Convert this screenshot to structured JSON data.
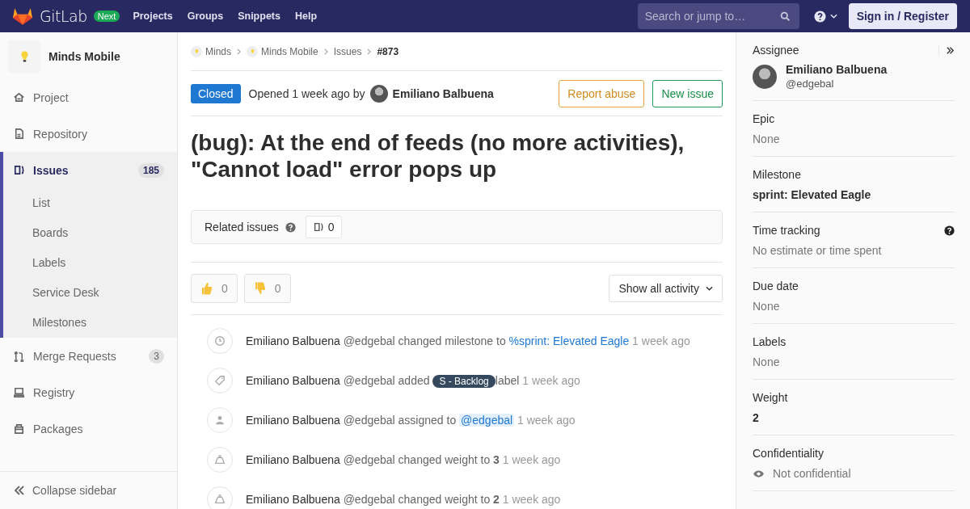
{
  "navbar": {
    "brand": "GitLab",
    "badge": "Next",
    "links": [
      "Projects",
      "Groups",
      "Snippets",
      "Help"
    ],
    "search": {
      "placeholder": "Search or jump to…"
    },
    "sign_in": "Sign in / Register"
  },
  "sidebar": {
    "project": "Minds Mobile",
    "items": [
      {
        "label": "Project",
        "kind": "home",
        "selected": false
      },
      {
        "label": "Repository",
        "kind": "doc",
        "selected": false
      },
      {
        "label": "Issues",
        "kind": "issues",
        "selected": true,
        "count": "185",
        "children": [
          {
            "label": "List"
          },
          {
            "label": "Boards"
          },
          {
            "label": "Labels"
          },
          {
            "label": "Service Desk"
          },
          {
            "label": "Milestones"
          }
        ]
      },
      {
        "label": "Merge Requests",
        "kind": "merge",
        "selected": false,
        "count": "3"
      },
      {
        "label": "Registry",
        "kind": "registry",
        "selected": false
      },
      {
        "label": "Packages",
        "kind": "package",
        "selected": false
      }
    ],
    "collapse": "Collapse sidebar"
  },
  "breadcrumbs": [
    {
      "label": "Minds",
      "icon": true
    },
    {
      "label": "Minds Mobile",
      "icon": true
    },
    {
      "label": "Issues",
      "icon": false
    },
    {
      "label": "#873",
      "icon": false
    }
  ],
  "issue": {
    "status": "Closed",
    "opened": "Opened 1 week ago by",
    "author": "Emiliano Balbuena",
    "report": "Report abuse",
    "new_issue": "New issue",
    "title": "(bug): At the end of feeds (no more activities), \"Cannot load\" error pops up"
  },
  "related": {
    "label": "Related issues",
    "count": "0"
  },
  "reactions": [
    {
      "kind": "up",
      "count": "0"
    },
    {
      "kind": "down",
      "count": "0"
    }
  ],
  "activity_filter": "Show all activity",
  "activity": [
    {
      "kind": "clock",
      "author": "Emiliano Balbuena",
      "handle": "@edgebal",
      "action": "changed milestone to",
      "ref": {
        "kind": "link",
        "text": "%sprint: Elevated Eagle"
      },
      "time": "1 week ago"
    },
    {
      "kind": "tag",
      "author": "Emiliano Balbuena",
      "handle": "@edgebal",
      "action": "added",
      "ref": {
        "kind": "label",
        "text": "S - Backlog"
      },
      "after": "label",
      "time": "1 week ago"
    },
    {
      "kind": "user",
      "author": "Emiliano Balbuena",
      "handle": "@edgebal",
      "action": "assigned to",
      "ref": {
        "kind": "mention",
        "text": "@edgebal"
      },
      "time": "1 week ago"
    },
    {
      "kind": "weight",
      "author": "Emiliano Balbuena",
      "handle": "@edgebal",
      "action": "changed weight to **3**",
      "time": "1 week ago"
    },
    {
      "kind": "weight",
      "author": "Emiliano Balbuena",
      "handle": "@edgebal",
      "action": "changed weight to **2**",
      "time": "1 week ago"
    }
  ],
  "right_sidebar": {
    "assignee": {
      "label": "Assignee",
      "name": "Emiliano Balbuena",
      "handle": "@edgebal"
    },
    "blocks": [
      {
        "label": "Epic",
        "value": "None",
        "kind": "muted"
      },
      {
        "label": "Milestone",
        "value": "sprint: Elevated Eagle",
        "kind": "bold"
      },
      {
        "label": "Time tracking",
        "value": "No estimate or time spent",
        "kind": "muted",
        "help": true
      },
      {
        "label": "Due date",
        "value": "None",
        "kind": "muted"
      },
      {
        "label": "Labels",
        "value": "None",
        "kind": "muted"
      },
      {
        "label": "Weight",
        "value": "2",
        "kind": "bold"
      },
      {
        "label": "Confidentiality",
        "value": "Not confidential",
        "kind": "eye"
      }
    ]
  }
}
